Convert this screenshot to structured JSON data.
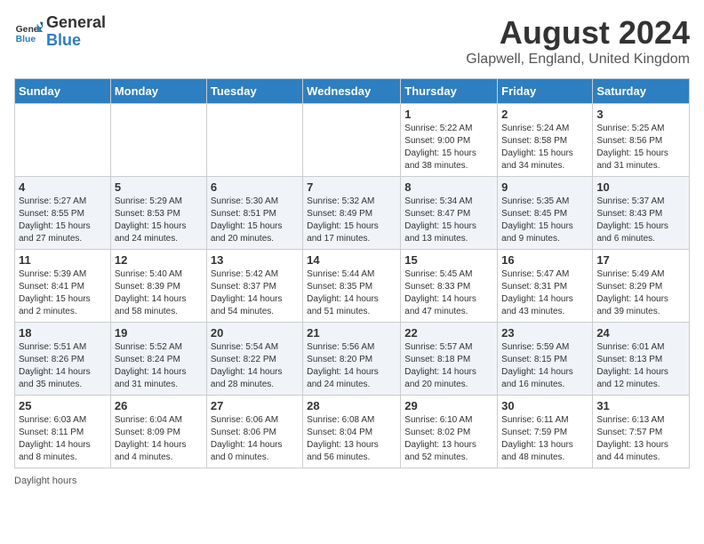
{
  "header": {
    "logo_line1": "General",
    "logo_line2": "Blue",
    "month_title": "August 2024",
    "location": "Glapwell, England, United Kingdom"
  },
  "weekdays": [
    "Sunday",
    "Monday",
    "Tuesday",
    "Wednesday",
    "Thursday",
    "Friday",
    "Saturday"
  ],
  "weeks": [
    [
      {
        "day": "",
        "info": ""
      },
      {
        "day": "",
        "info": ""
      },
      {
        "day": "",
        "info": ""
      },
      {
        "day": "",
        "info": ""
      },
      {
        "day": "1",
        "info": "Sunrise: 5:22 AM\nSunset: 9:00 PM\nDaylight: 15 hours\nand 38 minutes."
      },
      {
        "day": "2",
        "info": "Sunrise: 5:24 AM\nSunset: 8:58 PM\nDaylight: 15 hours\nand 34 minutes."
      },
      {
        "day": "3",
        "info": "Sunrise: 5:25 AM\nSunset: 8:56 PM\nDaylight: 15 hours\nand 31 minutes."
      }
    ],
    [
      {
        "day": "4",
        "info": "Sunrise: 5:27 AM\nSunset: 8:55 PM\nDaylight: 15 hours\nand 27 minutes."
      },
      {
        "day": "5",
        "info": "Sunrise: 5:29 AM\nSunset: 8:53 PM\nDaylight: 15 hours\nand 24 minutes."
      },
      {
        "day": "6",
        "info": "Sunrise: 5:30 AM\nSunset: 8:51 PM\nDaylight: 15 hours\nand 20 minutes."
      },
      {
        "day": "7",
        "info": "Sunrise: 5:32 AM\nSunset: 8:49 PM\nDaylight: 15 hours\nand 17 minutes."
      },
      {
        "day": "8",
        "info": "Sunrise: 5:34 AM\nSunset: 8:47 PM\nDaylight: 15 hours\nand 13 minutes."
      },
      {
        "day": "9",
        "info": "Sunrise: 5:35 AM\nSunset: 8:45 PM\nDaylight: 15 hours\nand 9 minutes."
      },
      {
        "day": "10",
        "info": "Sunrise: 5:37 AM\nSunset: 8:43 PM\nDaylight: 15 hours\nand 6 minutes."
      }
    ],
    [
      {
        "day": "11",
        "info": "Sunrise: 5:39 AM\nSunset: 8:41 PM\nDaylight: 15 hours\nand 2 minutes."
      },
      {
        "day": "12",
        "info": "Sunrise: 5:40 AM\nSunset: 8:39 PM\nDaylight: 14 hours\nand 58 minutes."
      },
      {
        "day": "13",
        "info": "Sunrise: 5:42 AM\nSunset: 8:37 PM\nDaylight: 14 hours\nand 54 minutes."
      },
      {
        "day": "14",
        "info": "Sunrise: 5:44 AM\nSunset: 8:35 PM\nDaylight: 14 hours\nand 51 minutes."
      },
      {
        "day": "15",
        "info": "Sunrise: 5:45 AM\nSunset: 8:33 PM\nDaylight: 14 hours\nand 47 minutes."
      },
      {
        "day": "16",
        "info": "Sunrise: 5:47 AM\nSunset: 8:31 PM\nDaylight: 14 hours\nand 43 minutes."
      },
      {
        "day": "17",
        "info": "Sunrise: 5:49 AM\nSunset: 8:29 PM\nDaylight: 14 hours\nand 39 minutes."
      }
    ],
    [
      {
        "day": "18",
        "info": "Sunrise: 5:51 AM\nSunset: 8:26 PM\nDaylight: 14 hours\nand 35 minutes."
      },
      {
        "day": "19",
        "info": "Sunrise: 5:52 AM\nSunset: 8:24 PM\nDaylight: 14 hours\nand 31 minutes."
      },
      {
        "day": "20",
        "info": "Sunrise: 5:54 AM\nSunset: 8:22 PM\nDaylight: 14 hours\nand 28 minutes."
      },
      {
        "day": "21",
        "info": "Sunrise: 5:56 AM\nSunset: 8:20 PM\nDaylight: 14 hours\nand 24 minutes."
      },
      {
        "day": "22",
        "info": "Sunrise: 5:57 AM\nSunset: 8:18 PM\nDaylight: 14 hours\nand 20 minutes."
      },
      {
        "day": "23",
        "info": "Sunrise: 5:59 AM\nSunset: 8:15 PM\nDaylight: 14 hours\nand 16 minutes."
      },
      {
        "day": "24",
        "info": "Sunrise: 6:01 AM\nSunset: 8:13 PM\nDaylight: 14 hours\nand 12 minutes."
      }
    ],
    [
      {
        "day": "25",
        "info": "Sunrise: 6:03 AM\nSunset: 8:11 PM\nDaylight: 14 hours\nand 8 minutes."
      },
      {
        "day": "26",
        "info": "Sunrise: 6:04 AM\nSunset: 8:09 PM\nDaylight: 14 hours\nand 4 minutes."
      },
      {
        "day": "27",
        "info": "Sunrise: 6:06 AM\nSunset: 8:06 PM\nDaylight: 14 hours\nand 0 minutes."
      },
      {
        "day": "28",
        "info": "Sunrise: 6:08 AM\nSunset: 8:04 PM\nDaylight: 13 hours\nand 56 minutes."
      },
      {
        "day": "29",
        "info": "Sunrise: 6:10 AM\nSunset: 8:02 PM\nDaylight: 13 hours\nand 52 minutes."
      },
      {
        "day": "30",
        "info": "Sunrise: 6:11 AM\nSunset: 7:59 PM\nDaylight: 13 hours\nand 48 minutes."
      },
      {
        "day": "31",
        "info": "Sunrise: 6:13 AM\nSunset: 7:57 PM\nDaylight: 13 hours\nand 44 minutes."
      }
    ]
  ],
  "footer": "Daylight hours"
}
